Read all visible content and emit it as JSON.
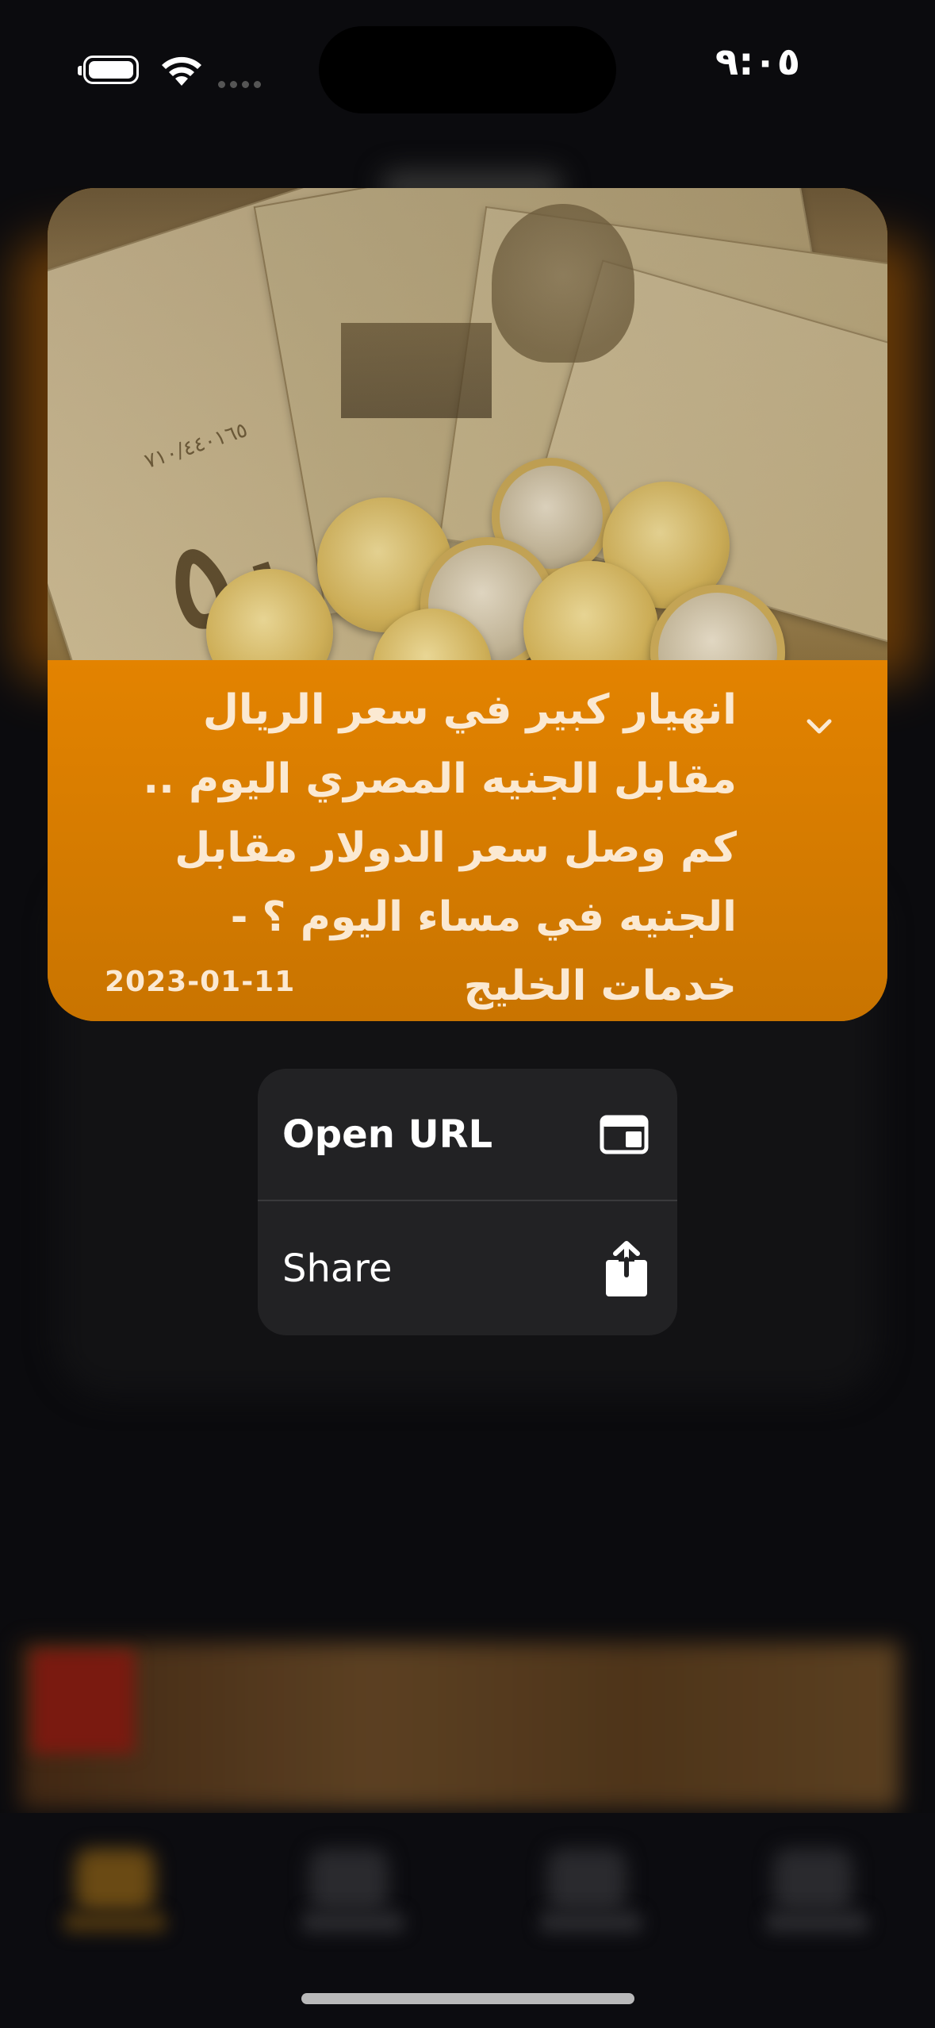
{
  "status_bar": {
    "time": "٩:٠٥"
  },
  "card": {
    "headline": "انهيار كبير في سعر الريال مقابل الجنيه المصري اليوم .. كم وصل سعر الدولار مقابل الجنيه في مساء اليوم ؟ - خدمات الخليج",
    "date": "2023-01-11",
    "accent_color": "#e38300",
    "expand_icon": "chevron-down-icon"
  },
  "context_menu": {
    "items": [
      {
        "label": "Open URL",
        "icon": "browser-window-icon"
      },
      {
        "label": "Share",
        "icon": "share-icon"
      }
    ]
  }
}
